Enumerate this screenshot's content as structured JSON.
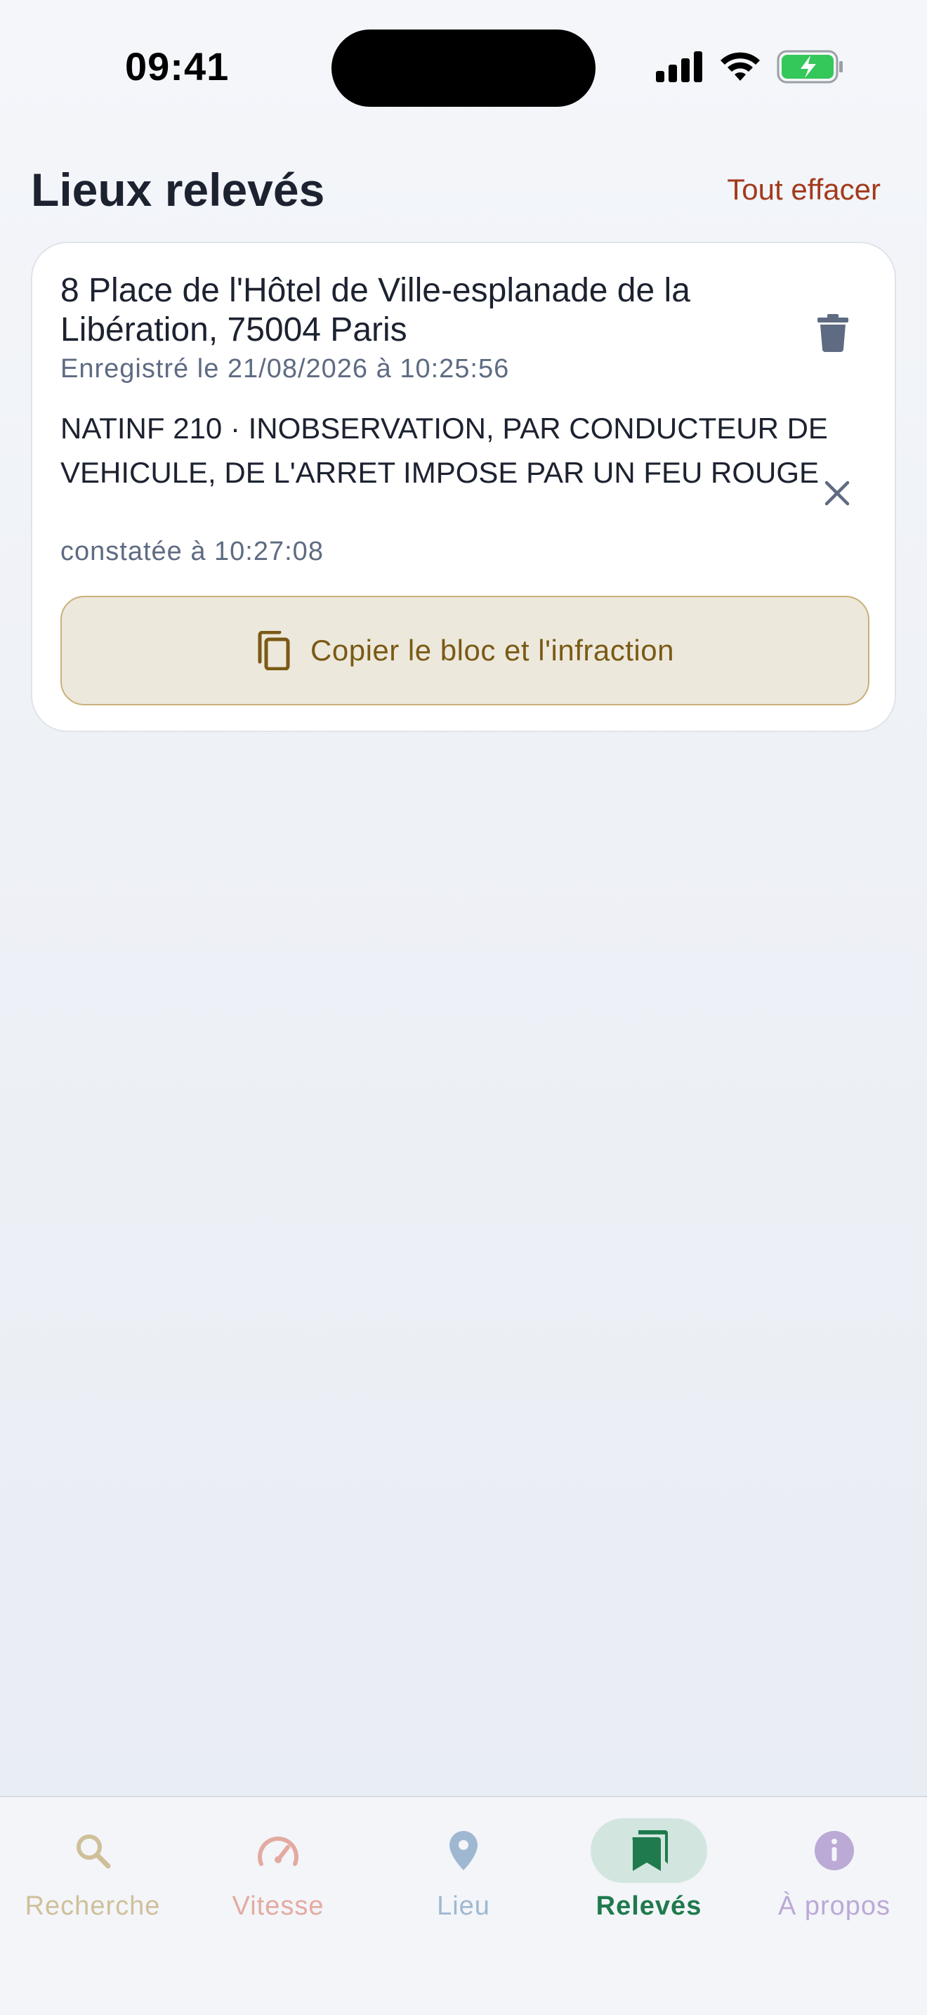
{
  "status_bar": {
    "time": "09:41"
  },
  "header": {
    "title": "Lieux relevés",
    "clear_all_label": "Tout effacer"
  },
  "card": {
    "address": "8 Place de l'Hôtel de Ville-esplanade de la Libération, 75004 Paris",
    "recorded": "Enregistré le 21/08/2026 à 10:25:56",
    "infraction": "NATINF 210 · INOBSERVATION, PAR CONDUCTEUR DE VEHICULE, DE L'ARRET IMPOSE PAR UN FEU ROUGE",
    "observed": "constatée à 10:27:08",
    "copy_label": "Copier le bloc et l'infraction"
  },
  "tabs": [
    {
      "label": "Recherche",
      "icon": "search-icon",
      "color": "#cfc09a",
      "active": false
    },
    {
      "label": "Vitesse",
      "icon": "speedometer-icon",
      "color": "#e3aaa0",
      "active": false
    },
    {
      "label": "Lieu",
      "icon": "location-pin-icon",
      "color": "#9fb8d2",
      "active": false
    },
    {
      "label": "Relevés",
      "icon": "bookmarks-icon",
      "color": "#1f7a4d",
      "active": true
    },
    {
      "label": "À propos",
      "icon": "info-icon",
      "color": "#bba9d6",
      "active": false
    }
  ],
  "colors": {
    "accent_red": "#a23a1c",
    "accent_gold": "#7a5a14",
    "active_tab": "#1f7a4d",
    "battery_green": "#34c759"
  }
}
